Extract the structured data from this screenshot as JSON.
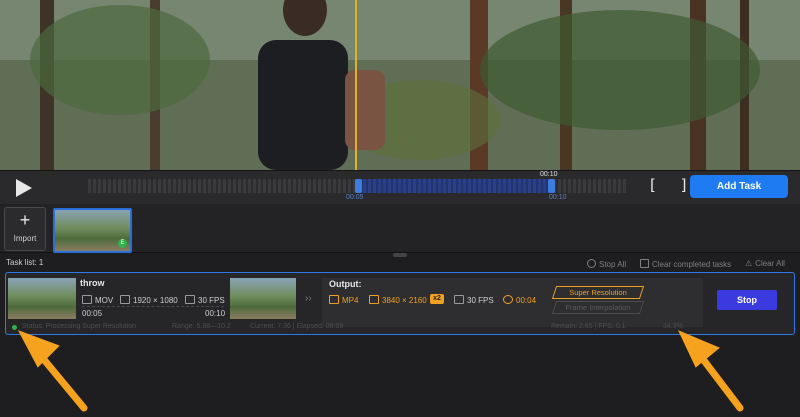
{
  "controls": {
    "time_top": "00:10",
    "time_start": "00:05",
    "time_end": "00:10",
    "brackets": "[ ]",
    "add_task_label": "Add Task"
  },
  "media": {
    "import_label": "Import",
    "badge": "E"
  },
  "task_list": {
    "header": "Task list: 1",
    "stop_all": "Stop All",
    "clear_completed": "Clear completed tasks",
    "clear_all": "Clear All"
  },
  "task": {
    "name": "throw",
    "input": {
      "format": "MOV",
      "resolution": "1920 × 1080",
      "fps": "30 FPS",
      "trim_start": "00:05",
      "trim_end": "00:10"
    },
    "output": {
      "label": "Output:",
      "format": "MP4",
      "resolution": "3840 × 2160",
      "scale": "x2",
      "fps": "30 FPS",
      "duration": "00:04"
    },
    "super_resolution_label": "Super Resolution",
    "frame_interpolation_label": "Frame Interpolation",
    "stop_label": "Stop",
    "status": "Status: Processing Super Resolution",
    "range": "Range: 5.98—10.2",
    "current_elapsed": "Current: 7.36 | Elapsed: 08:09",
    "remain_fps": "Remain: 2.65 | FPS: 0.1",
    "progress_text": "34.3%",
    "progress": 0.343
  },
  "colors": {
    "accent_blue": "#1f7bf2",
    "highlight_orange": "#f0a020",
    "stop_button": "#3a3adf",
    "status_green": "#2fb24a"
  }
}
